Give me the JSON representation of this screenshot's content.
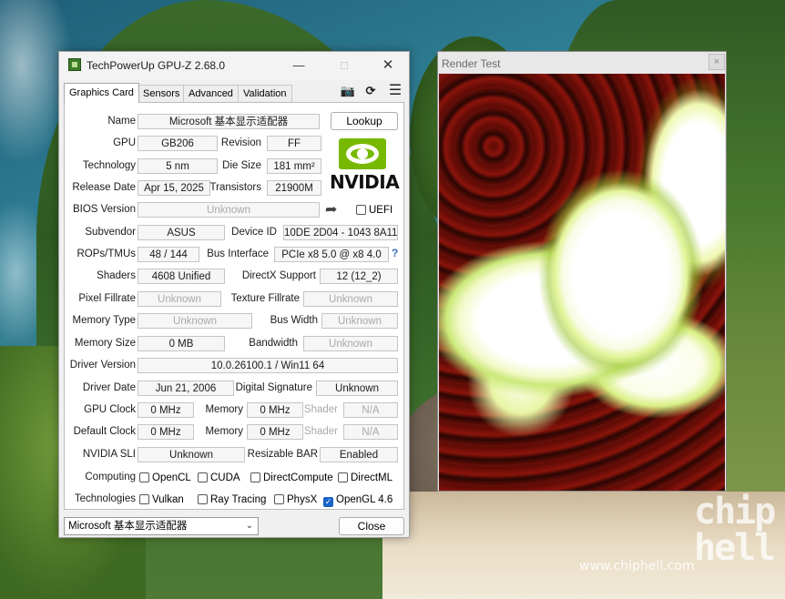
{
  "gpuz": {
    "title": "TechPowerUp GPU-Z 2.68.0",
    "tabs": [
      "Graphics Card",
      "Sensors",
      "Advanced",
      "Validation"
    ],
    "toolbar_icons": [
      "camera-icon",
      "refresh-icon",
      "menu-icon"
    ],
    "labels": {
      "name": "Name",
      "gpu": "GPU",
      "revision": "Revision",
      "technology": "Technology",
      "die_size": "Die Size",
      "release_date": "Release Date",
      "transistors": "Transistors",
      "bios_version": "BIOS Version",
      "uefi": "UEFI",
      "subvendor": "Subvendor",
      "device_id": "Device ID",
      "rops_tmus": "ROPs/TMUs",
      "bus_interface": "Bus Interface",
      "shaders": "Shaders",
      "directx_support": "DirectX Support",
      "pixel_fillrate": "Pixel Fillrate",
      "texture_fillrate": "Texture Fillrate",
      "memory_type": "Memory Type",
      "bus_width": "Bus Width",
      "memory_size": "Memory Size",
      "bandwidth": "Bandwidth",
      "driver_version": "Driver Version",
      "driver_date": "Driver Date",
      "digital_signature": "Digital Signature",
      "gpu_clock": "GPU Clock",
      "memory": "Memory",
      "shader": "Shader",
      "default_clock": "Default Clock",
      "nvidia_sli": "NVIDIA SLI",
      "resizable_bar": "Resizable BAR",
      "computing": "Computing",
      "technologies": "Technologies"
    },
    "values": {
      "name": "Microsoft 基本显示适配器",
      "gpu": "GB206",
      "revision": "FF",
      "technology": "5 nm",
      "die_size": "181 mm²",
      "release_date": "Apr 15, 2025",
      "transistors": "21900M",
      "bios_version": "Unknown",
      "subvendor": "ASUS",
      "device_id": "10DE 2D04 - 1043 8A11",
      "rops_tmus": "48 / 144",
      "bus_interface": "PCIe x8 5.0 @ x8 4.0",
      "shaders": "4608 Unified",
      "directx_support": "12 (12_2)",
      "pixel_fillrate": "Unknown",
      "texture_fillrate": "Unknown",
      "memory_type": "Unknown",
      "bus_width": "Unknown",
      "memory_size": "0 MB",
      "bandwidth": "Unknown",
      "driver_version": "10.0.26100.1 / Win11 64",
      "driver_date": "Jun 21, 2006",
      "digital_signature": "Unknown",
      "gpu_clock": "0 MHz",
      "gpu_memory": "0 MHz",
      "gpu_shader": "N/A",
      "default_clock": "0 MHz",
      "default_memory": "0 MHz",
      "default_shader": "N/A",
      "nvidia_sli": "Unknown",
      "resizable_bar": "Enabled"
    },
    "lookup_button": "Lookup",
    "help_mark": "?",
    "vendor_logo_text": "NVIDIA",
    "computing": [
      {
        "label": "OpenCL",
        "checked": false
      },
      {
        "label": "CUDA",
        "checked": false
      },
      {
        "label": "DirectCompute",
        "checked": false
      },
      {
        "label": "DirectML",
        "checked": false
      }
    ],
    "technologies": [
      {
        "label": "Vulkan",
        "checked": false
      },
      {
        "label": "Ray Tracing",
        "checked": false
      },
      {
        "label": "PhysX",
        "checked": false
      },
      {
        "label": "OpenGL 4.6",
        "checked": true
      }
    ],
    "device_select": "Microsoft 基本显示适配器",
    "close_button": "Close",
    "accent_color": "#1a62c6",
    "nvidia_green": "#76b900"
  },
  "render_test": {
    "title": "Render Test",
    "close_glyph": "×"
  },
  "watermark": {
    "logo": "chip hell",
    "url": "www.chiphell.com"
  }
}
